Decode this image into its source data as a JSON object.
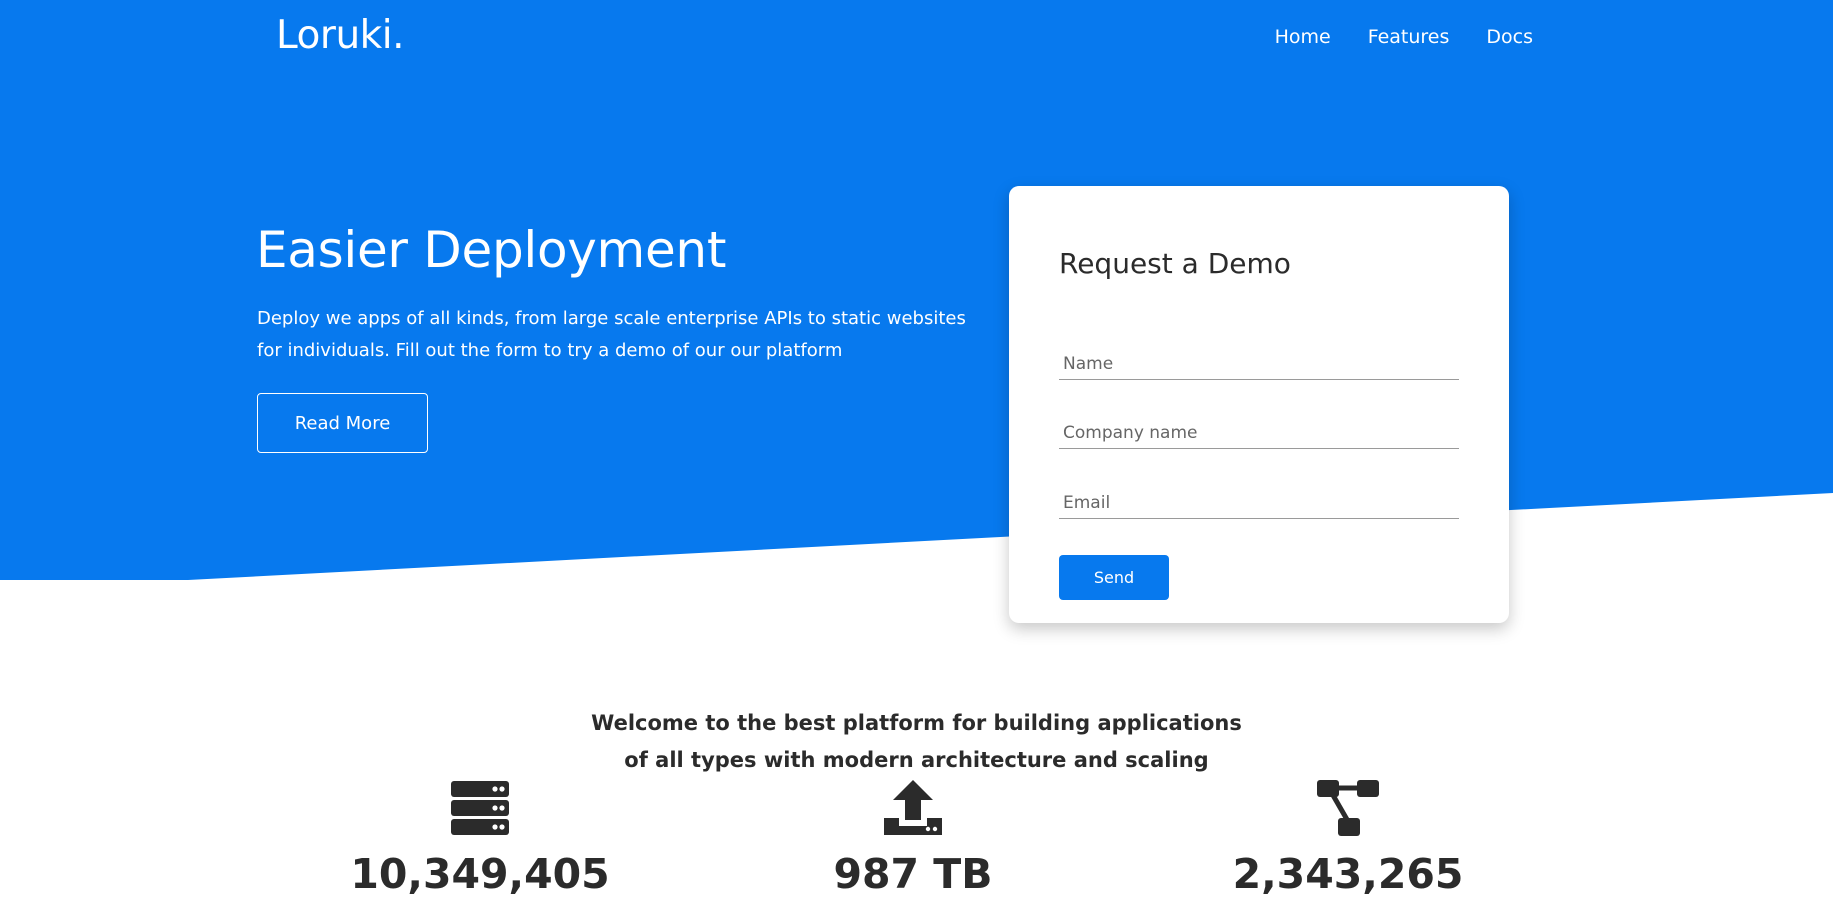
{
  "brand": {
    "logo": "Loruki.",
    "primary_color": "#0779ee"
  },
  "nav": {
    "items": [
      {
        "label": "Home"
      },
      {
        "label": "Features"
      },
      {
        "label": "Docs"
      }
    ]
  },
  "hero": {
    "title": "Easier Deployment",
    "text": "Deploy we apps of all kinds, from large scale enterprise APIs to static websites for individuals. Fill out the form to try a demo of our our platform",
    "read_more_label": "Read More"
  },
  "demo_form": {
    "title": "Request a Demo",
    "name_placeholder": "Name",
    "company_placeholder": "Company name",
    "email_placeholder": "Email",
    "send_label": "Send"
  },
  "welcome": {
    "line1": "Welcome to the best platform for building applications",
    "line2": "of all types with modern architecture and scaling"
  },
  "stats": [
    {
      "icon": "server-icon",
      "value": "10,349,405"
    },
    {
      "icon": "upload-icon",
      "value": "987 TB"
    },
    {
      "icon": "project-diagram-icon",
      "value": "2,343,265"
    }
  ]
}
